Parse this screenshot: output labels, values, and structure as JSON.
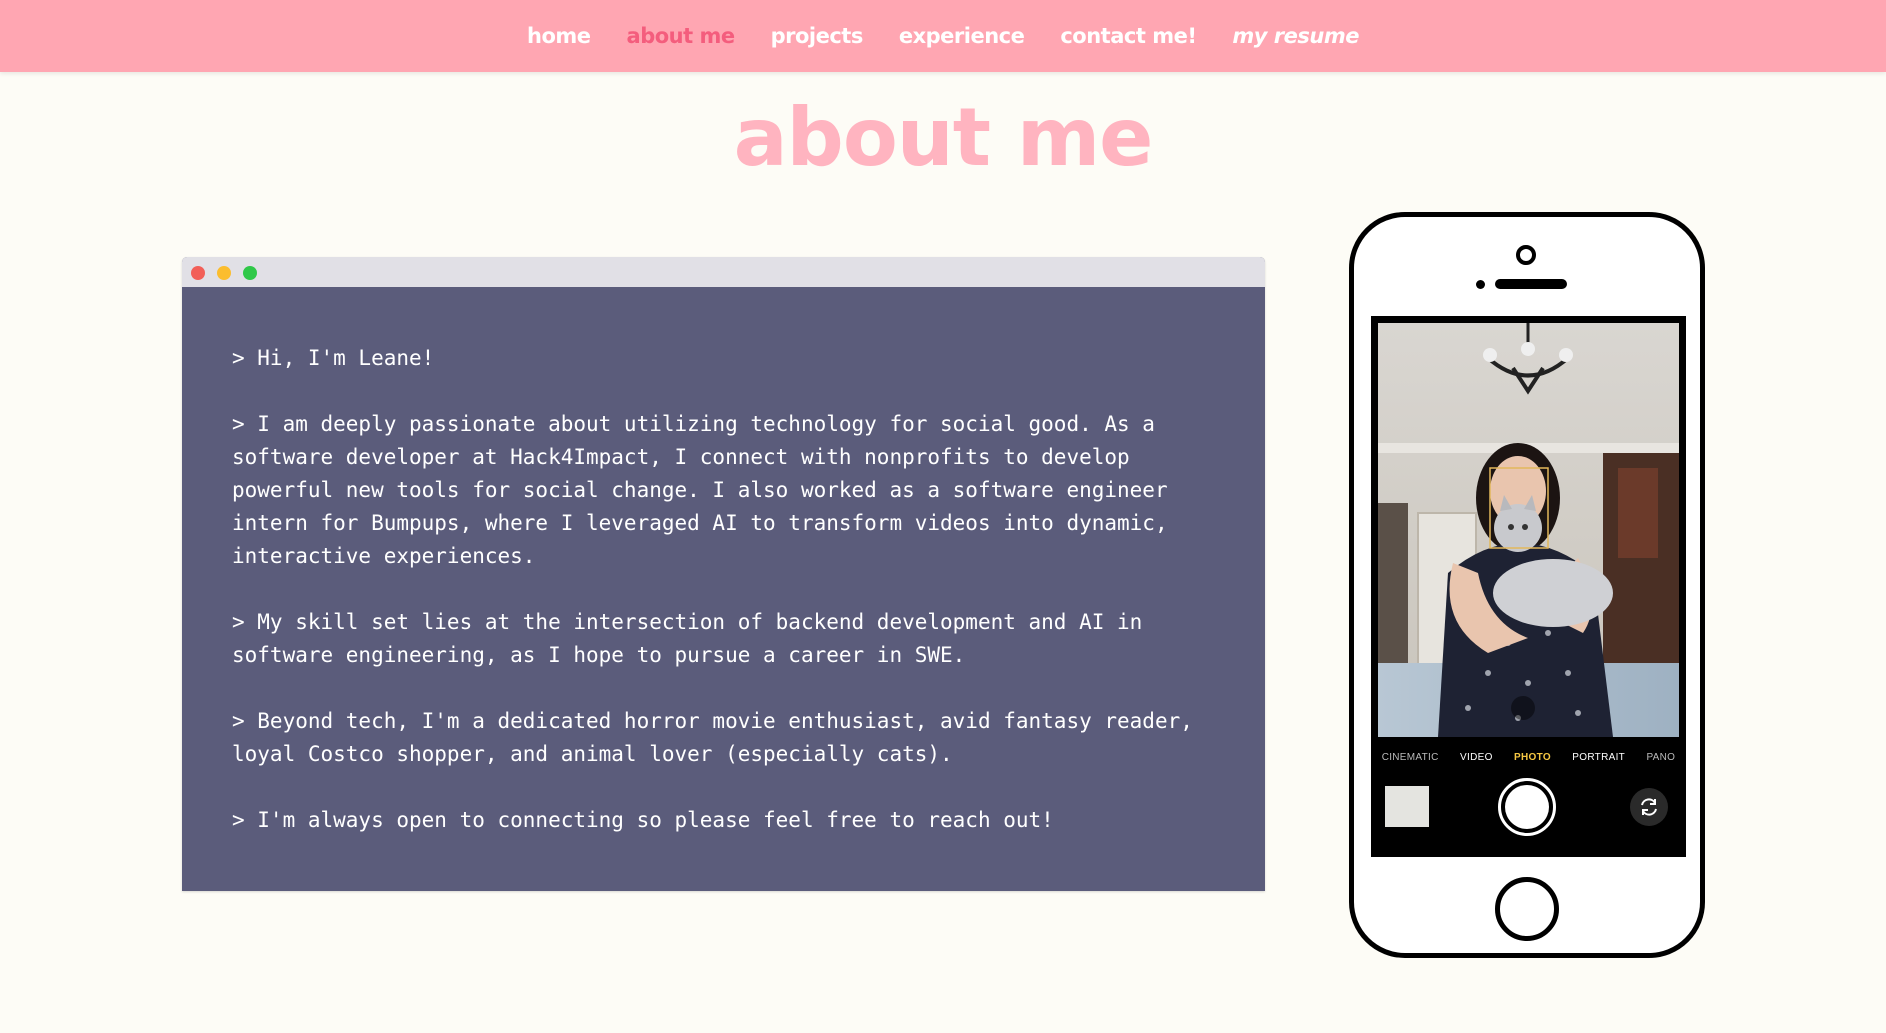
{
  "nav": {
    "items": [
      {
        "label": "home"
      },
      {
        "label": "about me"
      },
      {
        "label": "projects"
      },
      {
        "label": "experience"
      },
      {
        "label": "contact me!"
      },
      {
        "label": "my resume"
      }
    ]
  },
  "page": {
    "title": "about me"
  },
  "terminal": {
    "paragraphs": [
      "> Hi, I'm Leane!",
      "> I am deeply passionate about utilizing technology for social good. As a software developer at Hack4Impact, I connect with nonprofits to develop powerful new tools for social change. I also worked as a software engineer intern for Bumpups, where I leveraged AI to transform videos into dynamic, interactive experiences.",
      "> My skill set lies at the intersection of backend development and AI in software engineering, as I hope to pursue a career in SWE.",
      "> Beyond tech, I'm a dedicated horror movie enthusiast, avid fantasy reader, loyal Costco shopper, and animal lover (especially cats).",
      "> I'm always open to connecting so please feel free to reach out!"
    ]
  },
  "phone": {
    "modes": [
      "CINEMATIC",
      "VIDEO",
      "PHOTO",
      "PORTRAIT",
      "PANO"
    ],
    "selected_mode": "PHOTO"
  },
  "colors": {
    "nav_bg": "#ffa6b2",
    "nav_active": "#f45d7d",
    "title": "#ffb4c0",
    "terminal_bg": "#5b5c7b",
    "page_bg": "#fdfcf6"
  }
}
